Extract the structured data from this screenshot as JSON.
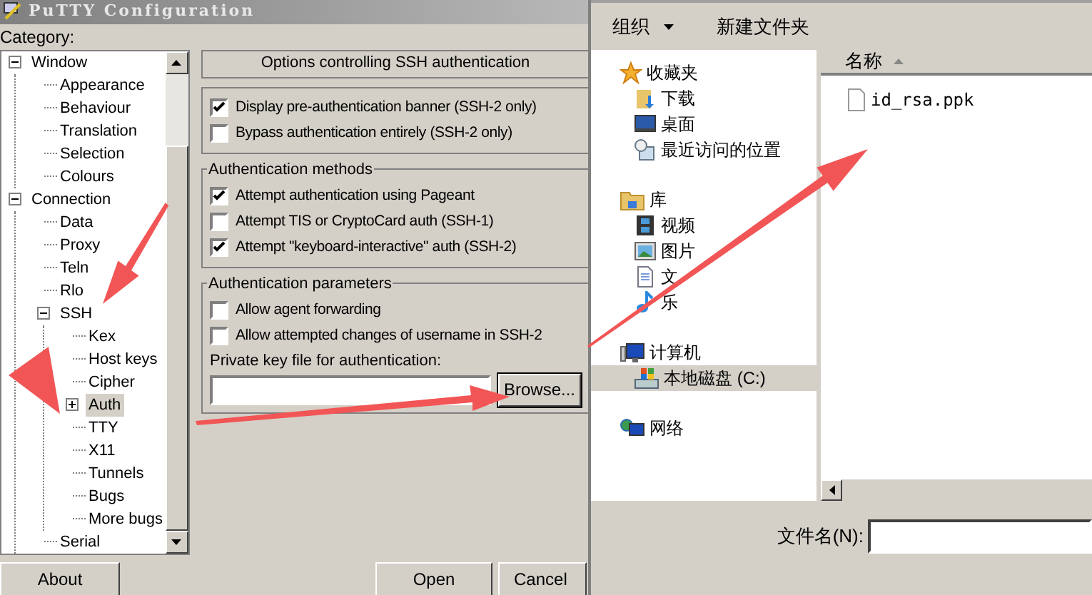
{
  "putty": {
    "title": "PuTTY Configuration",
    "category_label": "Category:",
    "tree": [
      {
        "label": "Window",
        "expanded": true,
        "selected": false,
        "children": [
          {
            "label": "Appearance",
            "selected": false
          },
          {
            "label": "Behaviour",
            "selected": false
          },
          {
            "label": "Translation",
            "selected": false
          },
          {
            "label": "Selection",
            "selected": false
          },
          {
            "label": "Colours",
            "selected": false
          }
        ]
      },
      {
        "label": "Connection",
        "expanded": true,
        "selected": false,
        "children": [
          {
            "label": "Data",
            "selected": false
          },
          {
            "label": "Proxy",
            "selected": false
          },
          {
            "label": "Teln",
            "selected": false
          },
          {
            "label": "Rlo",
            "selected": false
          },
          {
            "label": "SSH",
            "expanded": true,
            "selected": false,
            "children": [
              {
                "label": "Kex",
                "selected": false
              },
              {
                "label": "Host keys",
                "selected": false
              },
              {
                "label": "Cipher",
                "selected": false
              },
              {
                "label": "Auth",
                "expanded": false,
                "selected": true
              },
              {
                "label": "TTY",
                "selected": false
              },
              {
                "label": "X11",
                "selected": false
              },
              {
                "label": "Tunnels",
                "selected": false
              },
              {
                "label": "Bugs",
                "selected": false
              },
              {
                "label": "More bugs",
                "selected": false
              }
            ]
          },
          {
            "label": "Serial",
            "selected": false
          }
        ]
      }
    ],
    "panel_heading": "Options controlling SSH authentication",
    "groups": [
      {
        "options": [
          {
            "label": "Display pre-authentication banner (SSH-2 only)",
            "checked": true
          },
          {
            "label": "Bypass authentication entirely (SSH-2 only)",
            "checked": false
          }
        ]
      },
      {
        "title": "Authentication methods",
        "options": [
          {
            "label": "Attempt authentication using Pageant",
            "checked": true
          },
          {
            "label": "Attempt TIS or CryptoCard auth (SSH-1)",
            "checked": false
          },
          {
            "label": "Attempt \"keyboard-interactive\" auth (SSH-2)",
            "checked": true
          }
        ]
      },
      {
        "title": "Authentication parameters",
        "options": [
          {
            "label": "Allow agent forwarding",
            "checked": false
          },
          {
            "label": "Allow attempted changes of username in SSH-2",
            "checked": false
          }
        ],
        "key_file_label": "Private key file for authentication:",
        "browse_button": "Browse..."
      }
    ],
    "buttons": {
      "about": "About",
      "open": "Open",
      "cancel": "Cancel"
    }
  },
  "file_dialog": {
    "toolbar": {
      "organize": "组织",
      "new_folder": "新建文件夹"
    },
    "nav": [
      {
        "kind": "favorites",
        "label": "收藏夹",
        "selected": false,
        "children": [
          {
            "kind": "downloads",
            "label": "下载",
            "selected": false
          },
          {
            "kind": "desktop",
            "label": "桌面",
            "selected": false
          },
          {
            "kind": "recent",
            "label": "最近访问的位置",
            "selected": false
          }
        ]
      },
      {
        "kind": "library",
        "label": "库",
        "selected": false,
        "children": [
          {
            "kind": "videos",
            "label": "视频",
            "selected": false
          },
          {
            "kind": "pictures",
            "label": "图片",
            "selected": false
          },
          {
            "kind": "documents",
            "label": "文",
            "selected": false
          },
          {
            "kind": "music",
            "label": "乐",
            "selected": false
          }
        ]
      },
      {
        "kind": "computer",
        "label": "计算机",
        "selected": false,
        "children": [
          {
            "kind": "drive",
            "label": "本地磁盘 (C:)",
            "selected": true
          }
        ]
      },
      {
        "kind": "network",
        "label": "网络",
        "selected": false
      }
    ],
    "column_header": "名称",
    "files": [
      {
        "name": "id_rsa.ppk"
      }
    ],
    "filename_label": "文件名(N):"
  }
}
